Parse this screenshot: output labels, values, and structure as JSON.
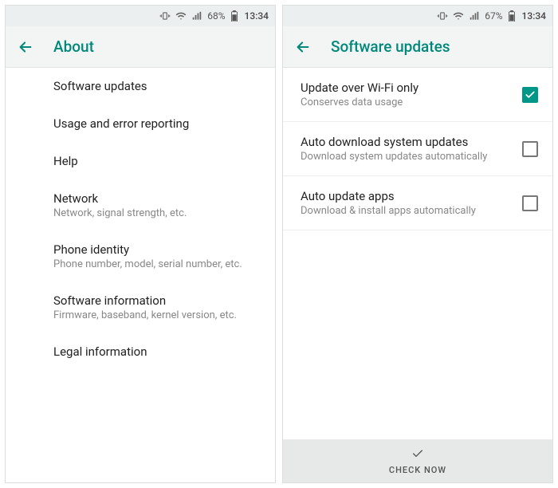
{
  "left": {
    "status": {
      "battery": "68%",
      "time": "13:34"
    },
    "title": "About",
    "items": [
      {
        "primary": "Software updates",
        "secondary": ""
      },
      {
        "primary": "Usage and error reporting",
        "secondary": ""
      },
      {
        "primary": "Help",
        "secondary": ""
      },
      {
        "primary": "Network",
        "secondary": "Network, signal strength, etc."
      },
      {
        "primary": "Phone identity",
        "secondary": "Phone number, model, serial number, etc."
      },
      {
        "primary": "Software information",
        "secondary": "Firmware, baseband, kernel version, etc."
      },
      {
        "primary": "Legal information",
        "secondary": ""
      }
    ]
  },
  "right": {
    "status": {
      "battery": "67%",
      "time": "13:34"
    },
    "title": "Software updates",
    "items": [
      {
        "primary": "Update over Wi-Fi only",
        "secondary": "Conserves data usage",
        "checked": true
      },
      {
        "primary": "Auto download system updates",
        "secondary": "Download system updates automatically",
        "checked": false
      },
      {
        "primary": "Auto update apps",
        "secondary": "Download & install apps automatically",
        "checked": false
      }
    ],
    "button": "CHECK NOW"
  }
}
